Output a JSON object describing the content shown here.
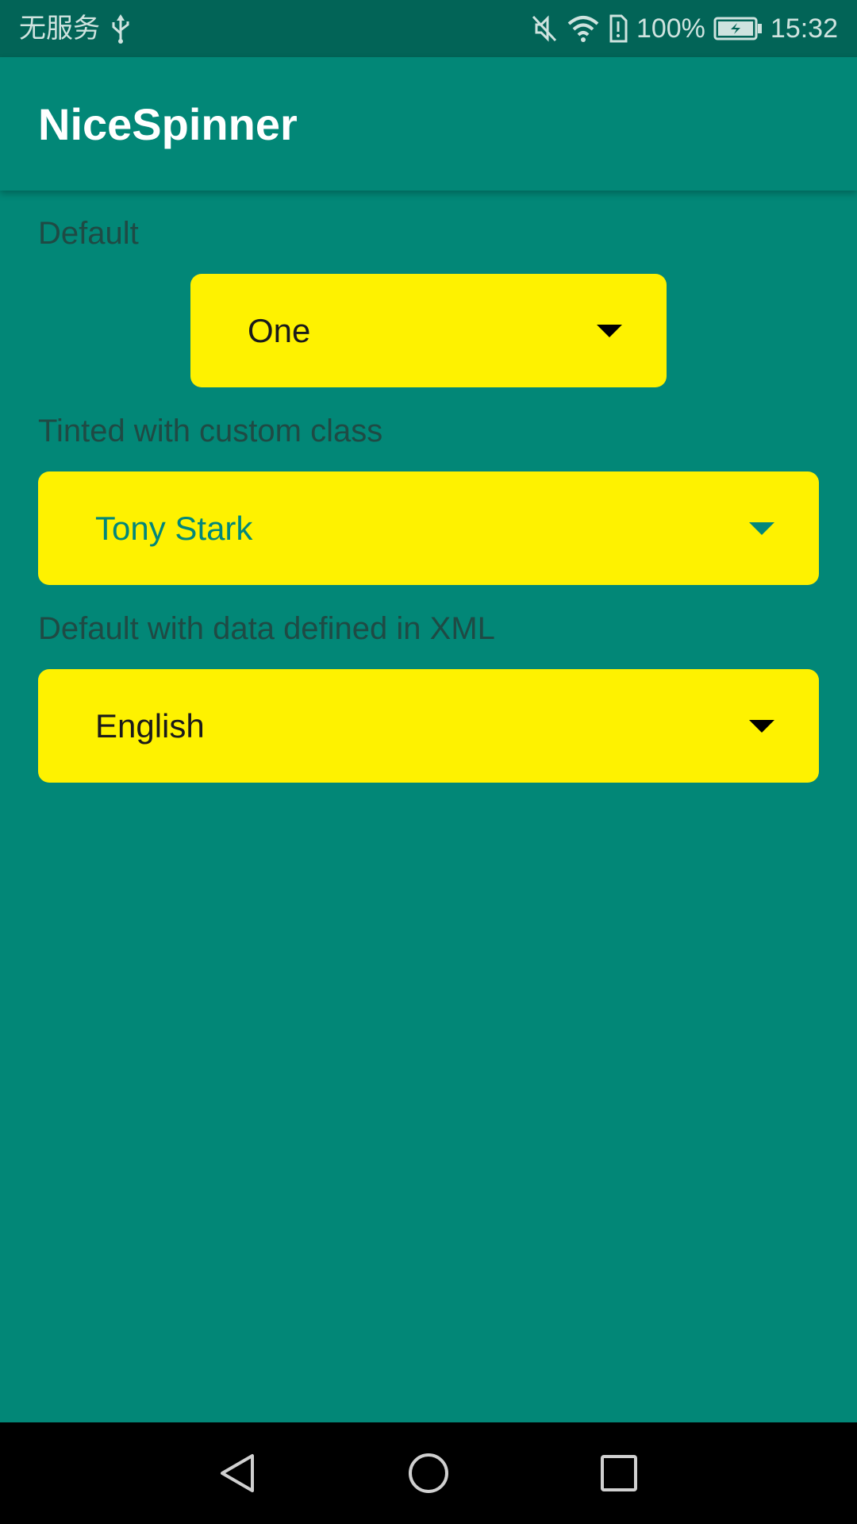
{
  "status_bar": {
    "carrier": "无服务",
    "battery_percent": "100%",
    "time": "15:32",
    "icons": [
      "usb-icon",
      "mute-icon",
      "wifi-icon",
      "sim-alert-icon",
      "battery-charging-icon"
    ]
  },
  "app_bar": {
    "title": "NiceSpinner"
  },
  "sections": [
    {
      "label": "Default",
      "selected": "One"
    },
    {
      "label": "Tinted with custom class",
      "selected": "Tony Stark"
    },
    {
      "label": "Default with data defined in XML",
      "selected": "English"
    }
  ],
  "colors": {
    "background": "#028777",
    "status_bar": "#026457",
    "spinner_bg": "#fef200",
    "tinted_text": "#02877a",
    "label_text": "#1f4a44"
  },
  "nav_bar": {
    "icons": [
      "back-icon",
      "home-icon",
      "recents-icon"
    ]
  }
}
